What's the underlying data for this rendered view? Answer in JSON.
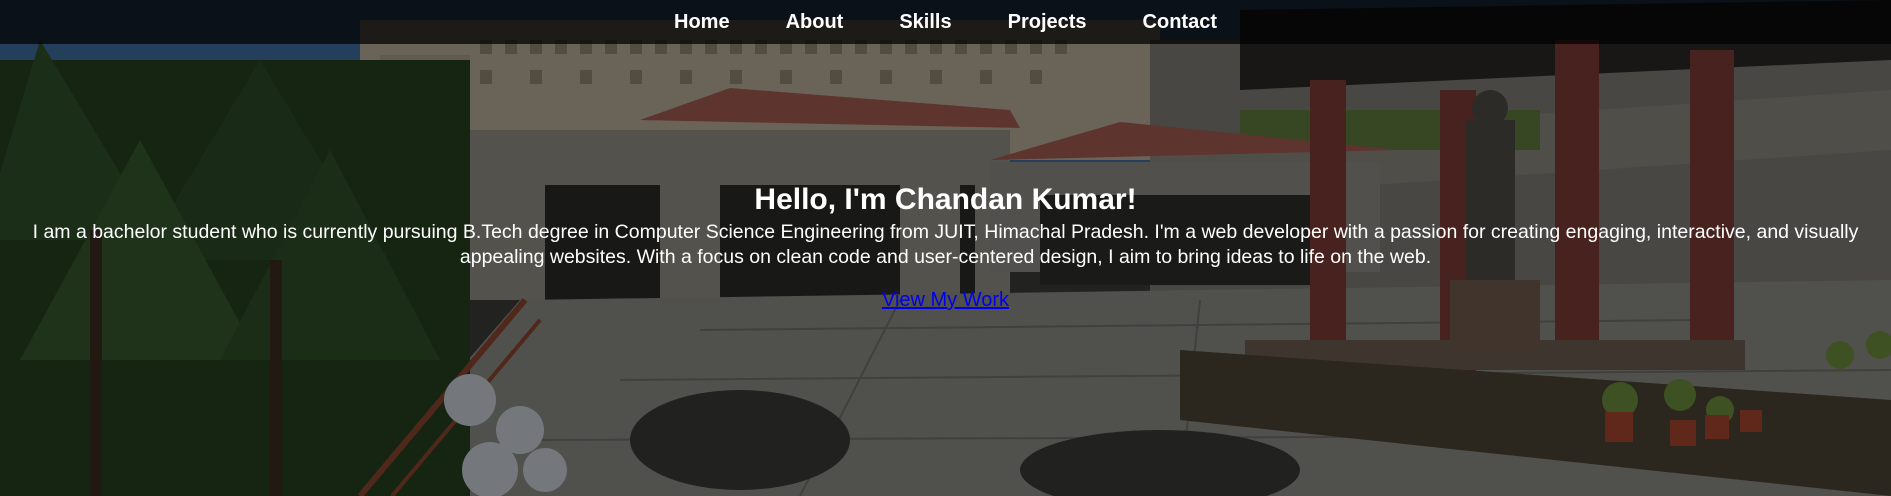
{
  "nav": {
    "items": [
      {
        "label": "Home"
      },
      {
        "label": "About"
      },
      {
        "label": "Skills"
      },
      {
        "label": "Projects"
      },
      {
        "label": "Contact"
      }
    ]
  },
  "hero": {
    "title": "Hello, I'm Chandan Kumar!",
    "description": "I am a bachelor student who is currently pursuing B.Tech degree in Computer Science Engineering from JUIT, Himachal Pradesh. I'm a web developer with a passion for creating engaging, interactive, and visually appealing websites. With a focus on clean code and user-centered design, I aim to bring ideas to life on the web.",
    "cta_label": "View My Work"
  },
  "colors": {
    "nav_background": "#0b0b0b",
    "text": "#ffffff",
    "link": "#0000ee"
  }
}
